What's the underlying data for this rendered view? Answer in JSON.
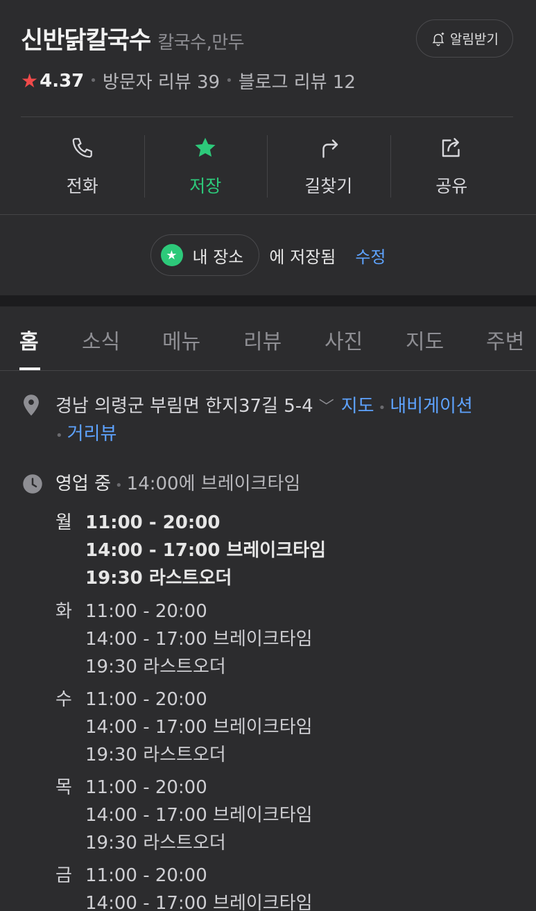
{
  "header": {
    "title": "신반닭칼국수",
    "category": "칼국수,만두",
    "alarm_label": "알림받기",
    "rating": "4.37",
    "visitor_reviews": "방문자 리뷰 39",
    "blog_reviews": "블로그 리뷰 12"
  },
  "actions": [
    {
      "label": "전화",
      "icon": "phone-icon"
    },
    {
      "label": "저장",
      "icon": "star-icon"
    },
    {
      "label": "길찾기",
      "icon": "directions-icon"
    },
    {
      "label": "공유",
      "icon": "share-icon"
    }
  ],
  "saved": {
    "list_name": "내 장소",
    "suffix": "에 저장됨",
    "edit_label": "수정"
  },
  "tabs": [
    "홈",
    "소식",
    "메뉴",
    "리뷰",
    "사진",
    "지도",
    "주변"
  ],
  "address": {
    "text": "경남 의령군 부림면 한지37길 5-4",
    "map_link": "지도",
    "nav_link": "내비게이션",
    "street_link": "거리뷰"
  },
  "hours": {
    "status": "영업 중",
    "status_sub": "14:00에 브레이크타임",
    "days": [
      {
        "name": "월",
        "lines": [
          "11:00 - 20:00",
          "14:00 - 17:00 브레이크타임",
          "19:30 라스트오더"
        ]
      },
      {
        "name": "화",
        "lines": [
          "11:00 - 20:00",
          "14:00 - 17:00 브레이크타임",
          "19:30 라스트오더"
        ]
      },
      {
        "name": "수",
        "lines": [
          "11:00 - 20:00",
          "14:00 - 17:00 브레이크타임",
          "19:30 라스트오더"
        ]
      },
      {
        "name": "목",
        "lines": [
          "11:00 - 20:00",
          "14:00 - 17:00 브레이크타임",
          "19:30 라스트오더"
        ]
      },
      {
        "name": "금",
        "lines": [
          "11:00 - 20:00",
          "14:00 - 17:00 브레이크타임"
        ]
      }
    ]
  },
  "colors": {
    "background": "#2c2c2e",
    "accent_green": "#2dc97a",
    "link_blue": "#5ea3ff",
    "rating_star": "#f04a4a"
  }
}
